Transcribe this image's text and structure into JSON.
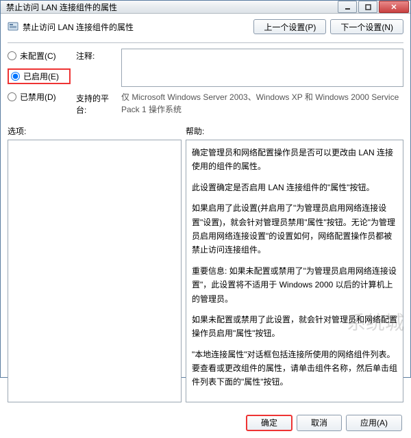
{
  "titlebar": {
    "text": "禁止访问 LAN 连接组件的属性"
  },
  "header": {
    "title": "禁止访问 LAN 连接组件的属性",
    "prev": "上一个设置(P)",
    "next": "下一个设置(N)"
  },
  "radios": {
    "not_configured": "未配置(C)",
    "enabled": "已启用(E)",
    "disabled": "已禁用(D)",
    "selected": "enabled"
  },
  "comment": {
    "label": "注释:",
    "value": ""
  },
  "platform": {
    "label": "支持的平台:",
    "text": "仅 Microsoft Windows Server 2003、Windows XP 和 Windows 2000 Service Pack 1 操作系统"
  },
  "panels": {
    "options_label": "选项:",
    "help_label": "帮助:",
    "help_paragraphs": [
      "确定管理员和网络配置操作员是否可以更改由 LAN 连接使用的组件的属性。",
      "此设置确定是否启用 LAN 连接组件的\"属性\"按钮。",
      "如果启用了此设置(并启用了\"为管理员启用网络连接设置\"设置)，就会针对管理员禁用\"属性\"按钮。无论\"为管理员启用网络连接设置\"的设置如何，网络配置操作员都被禁止访问连接组件。",
      "重要信息: 如果未配置或禁用了\"为管理员启用网络连接设置\"，此设置将不适用于 Windows 2000 以后的计算机上的管理员。",
      "如果未配置或禁用了此设置，就会针对管理员和网络配置操作员启用\"属性\"按钮。",
      "\"本地连接属性\"对话框包括连接所使用的网络组件列表。要查看或更改组件的属性，请单击组件名称，然后单击组件列表下面的\"属性\"按钮。"
    ]
  },
  "footer": {
    "ok": "确定",
    "cancel": "取消",
    "apply": "应用(A)"
  }
}
